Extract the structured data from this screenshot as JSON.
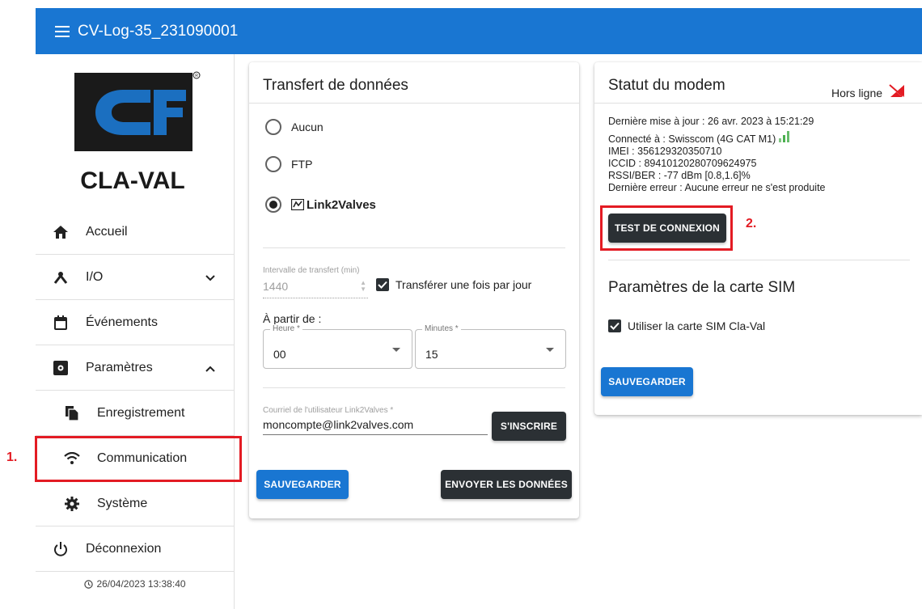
{
  "appbar": {
    "title": "CV-Log-35_231090001"
  },
  "logo": {
    "text": "CLA-VAL"
  },
  "sidebar": {
    "items": [
      {
        "label": "Accueil"
      },
      {
        "label": "I/O"
      },
      {
        "label": "Événements"
      },
      {
        "label": "Paramètres"
      },
      {
        "label": "Enregistrement"
      },
      {
        "label": "Communication"
      },
      {
        "label": "Système"
      },
      {
        "label": "Déconnexion"
      }
    ],
    "clock": "26/04/2023 13:38:40"
  },
  "callouts": {
    "one": "1.",
    "two": "2."
  },
  "transfer": {
    "title": "Transfert de données",
    "options": [
      "Aucun",
      "FTP"
    ],
    "link2valves_brand": "Link2Valves",
    "selected": "Link2Valves",
    "interval_label": "Intervalle de transfert (min)",
    "interval_value": "1440",
    "once_per_day_label": "Transférer une fois par jour",
    "once_per_day_checked": true,
    "from_label": "À partir de :",
    "hour_label": "Heure *",
    "hour_value": "00",
    "minutes_label": "Minutes *",
    "minutes_value": "15",
    "email_label": "Courriel de l'utilisateur Link2Valves *",
    "email_value": "moncompte@link2valves.com",
    "register_button": "S'INSCRIRE",
    "save_button": "SAUVEGARDER",
    "send_button": "ENVOYER LES DONNÉES"
  },
  "modem": {
    "title": "Statut du modem",
    "status": "Hors ligne",
    "status_color": "#e31b23",
    "last_update": "Dernière mise à jour : 26 avr. 2023 à 15:21:29",
    "connected_to": "Connecté à : Swisscom (4G CAT M1)",
    "imei": "IMEI : 356129320350710",
    "iccid": "ICCID : 89410120280709624975",
    "rssi": "RSSI/BER : -77 dBm [0.8,1.6]%",
    "last_error": "Dernière erreur : Aucune erreur ne s'est produite",
    "test_button": "TEST DE CONNEXION",
    "sim_title": "Paramètres de la carte SIM",
    "sim_checkbox_label": "Utiliser la carte SIM Cla-Val",
    "sim_checked": true,
    "save_button": "SAUVEGARDER"
  },
  "colors": {
    "primary": "#1976d2",
    "dark_button": "#2b3034",
    "callout": "#e31b23",
    "signal": "#4caf50"
  }
}
